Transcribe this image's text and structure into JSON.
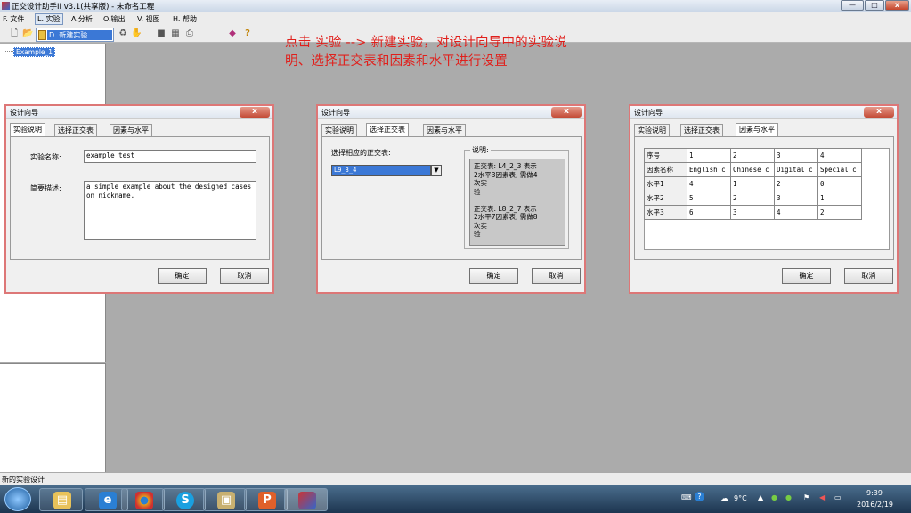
{
  "window": {
    "title": "正交设计助手II v3.1(共享版) - 未命名工程",
    "min": "—",
    "max": "□",
    "close": "x"
  },
  "menu": {
    "file": "F. 文件",
    "experiment": "L. 实验",
    "analysis": "A.分析",
    "output": "O.输出",
    "view": "V. 视图",
    "help": "H. 帮助"
  },
  "dropdown": {
    "new_experiment": "D. 新建实验"
  },
  "tree": {
    "item": "Example_1"
  },
  "note": {
    "line1": "点击 实验 --> 新建实验，对设计向导中的实验说",
    "line2": "明、选择正交表和因素和水平进行设置"
  },
  "tabs": {
    "desc": "实验说明",
    "table": "选择正交表",
    "factor": "因素与水平"
  },
  "dialog": {
    "title": "设计向导",
    "ok": "确定",
    "cancel": "取消",
    "close": "x"
  },
  "d1": {
    "name_label": "实验名称:",
    "name_value": "example_test",
    "desc_label": "简要描述:",
    "desc_value": "a simple example about the designed cases on nickname."
  },
  "d2": {
    "select_label": "选择相应的正交表:",
    "combo_value": "L9_3_4",
    "combo_arrow": "▼",
    "desc_label": "说明:",
    "desc_text": "正交表: L4_2_3 表示\n2水平3因素表, 需做4\n次实\n验\n\n正交表: L8_2_7 表示\n2水平7因素表, 需做8\n次实\n验"
  },
  "d3": {
    "header": [
      "序号",
      "1",
      "2",
      "3",
      "4"
    ],
    "rows": [
      [
        "因素名称",
        "English c",
        "Chinese c",
        "Digital c",
        "Special c"
      ],
      [
        "水平1",
        "4",
        "1",
        "2",
        "0"
      ],
      [
        "水平2",
        "5",
        "2",
        "3",
        "1"
      ],
      [
        "水平3",
        "6",
        "3",
        "4",
        "2"
      ]
    ]
  },
  "status": {
    "text": "新的实验设计"
  },
  "taskbar": {
    "temp": "9°C",
    "time": "9:39",
    "date": "2016/2/19"
  }
}
